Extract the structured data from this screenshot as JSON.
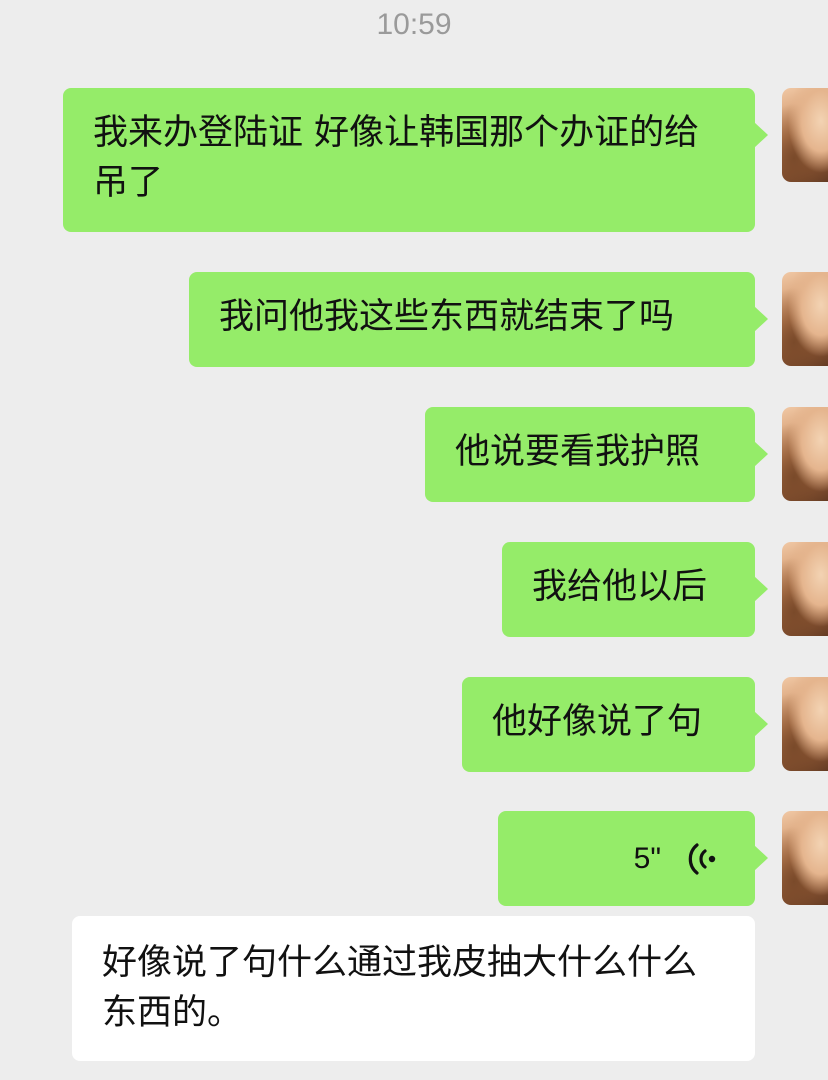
{
  "status": {
    "time": "10:59"
  },
  "messages": [
    {
      "text": "我来办登陆证 好像让韩国那个办证的给吊了"
    },
    {
      "text": "我问他我这些东西就结束了吗"
    },
    {
      "text": "他说要看我护照"
    },
    {
      "text": "我给他以后"
    },
    {
      "text": "他好像说了句"
    }
  ],
  "voice_message": {
    "duration": "5\"",
    "icon": "voice-wave-icon"
  },
  "transcript": {
    "text": "好像说了句什么通过我皮抽大什么什么东西的。"
  },
  "colors": {
    "sent_bubble": "#95ec69",
    "received_bubble": "#ffffff",
    "background": "#ededed"
  }
}
